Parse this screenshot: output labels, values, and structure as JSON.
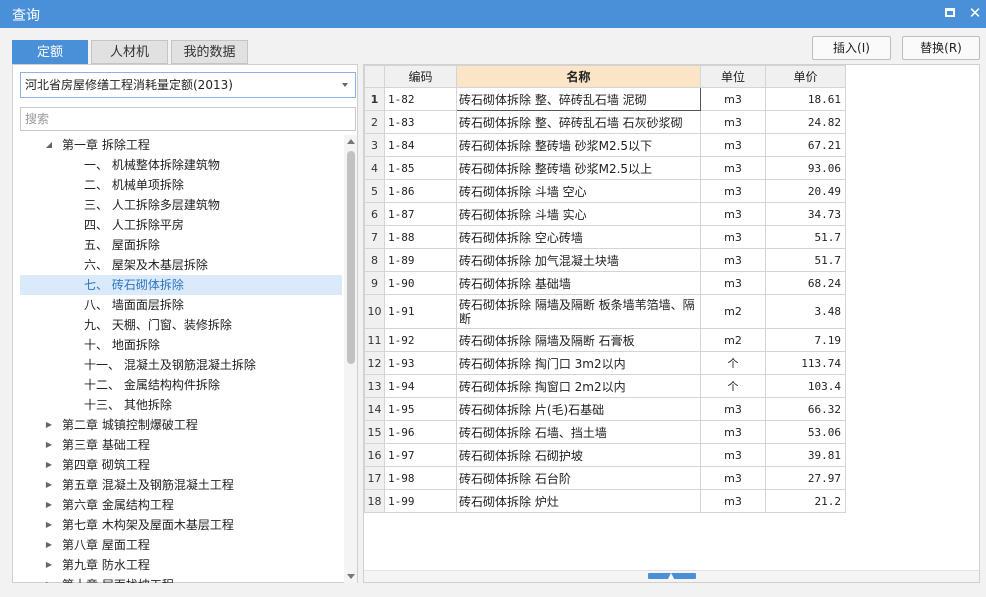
{
  "window": {
    "title": "查询",
    "maximize_label": "",
    "close_label": "✕"
  },
  "tabs": [
    {
      "label": "定额",
      "active": true
    },
    {
      "label": "人材机",
      "active": false
    },
    {
      "label": "我的数据",
      "active": false
    }
  ],
  "actions": {
    "insert_label": "插入(I)",
    "replace_label": "替换(R)"
  },
  "left": {
    "quota_select_value": "河北省房屋修缮工程消耗量定额(2013)",
    "search_placeholder": "搜索",
    "tree": [
      {
        "label": "第一章 拆除工程",
        "level": 1,
        "expanded": true,
        "selected": false
      },
      {
        "label": "一、 机械整体拆除建筑物",
        "level": 2,
        "selected": false
      },
      {
        "label": "二、 机械单项拆除",
        "level": 2,
        "selected": false
      },
      {
        "label": "三、 人工拆除多层建筑物",
        "level": 2,
        "selected": false
      },
      {
        "label": "四、 人工拆除平房",
        "level": 2,
        "selected": false
      },
      {
        "label": "五、 屋面拆除",
        "level": 2,
        "selected": false
      },
      {
        "label": "六、 屋架及木基层拆除",
        "level": 2,
        "selected": false
      },
      {
        "label": "七、 砖石砌体拆除",
        "level": 2,
        "selected": true
      },
      {
        "label": "八、 墙面面层拆除",
        "level": 2,
        "selected": false
      },
      {
        "label": "九、 天棚、门窗、装修拆除",
        "level": 2,
        "selected": false
      },
      {
        "label": "十、 地面拆除",
        "level": 2,
        "selected": false
      },
      {
        "label": "十一、 混凝土及钢筋混凝土拆除",
        "level": 2,
        "selected": false
      },
      {
        "label": "十二、 金属结构构件拆除",
        "level": 2,
        "selected": false
      },
      {
        "label": "十三、 其他拆除",
        "level": 2,
        "selected": false
      },
      {
        "label": "第二章 城镇控制爆破工程",
        "level": 1,
        "expanded": false,
        "selected": false
      },
      {
        "label": "第三章 基础工程",
        "level": 1,
        "expanded": false,
        "selected": false
      },
      {
        "label": "第四章 砌筑工程",
        "level": 1,
        "expanded": false,
        "selected": false
      },
      {
        "label": "第五章 混凝土及钢筋混凝土工程",
        "level": 1,
        "expanded": false,
        "selected": false
      },
      {
        "label": "第六章 金属结构工程",
        "level": 1,
        "expanded": false,
        "selected": false
      },
      {
        "label": "第七章 木构架及屋面木基层工程",
        "level": 1,
        "expanded": false,
        "selected": false
      },
      {
        "label": "第八章 屋面工程",
        "level": 1,
        "expanded": false,
        "selected": false
      },
      {
        "label": "第九章 防水工程",
        "level": 1,
        "expanded": false,
        "selected": false
      },
      {
        "label": "第十章 层面找坡工程",
        "level": 1,
        "expanded": false,
        "selected": false
      }
    ]
  },
  "grid": {
    "columns": [
      "编码",
      "名称",
      "单位",
      "单价"
    ],
    "sorted_column": "名称",
    "rows": [
      {
        "idx": "1",
        "code": "1-82",
        "name": "砖石砌体拆除 整、碎砖乱石墙 泥砌",
        "unit": "m3",
        "price": "18.61"
      },
      {
        "idx": "2",
        "code": "1-83",
        "name": "砖石砌体拆除 整、碎砖乱石墙 石灰砂浆砌",
        "unit": "m3",
        "price": "24.82"
      },
      {
        "idx": "3",
        "code": "1-84",
        "name": "砖石砌体拆除 整砖墙 砂浆M2.5以下",
        "unit": "m3",
        "price": "67.21"
      },
      {
        "idx": "4",
        "code": "1-85",
        "name": "砖石砌体拆除 整砖墙 砂浆M2.5以上",
        "unit": "m3",
        "price": "93.06"
      },
      {
        "idx": "5",
        "code": "1-86",
        "name": "砖石砌体拆除 斗墙 空心",
        "unit": "m3",
        "price": "20.49"
      },
      {
        "idx": "6",
        "code": "1-87",
        "name": "砖石砌体拆除 斗墙 实心",
        "unit": "m3",
        "price": "34.73"
      },
      {
        "idx": "7",
        "code": "1-88",
        "name": "砖石砌体拆除 空心砖墙",
        "unit": "m3",
        "price": "51.7"
      },
      {
        "idx": "8",
        "code": "1-89",
        "name": "砖石砌体拆除 加气混凝土块墙",
        "unit": "m3",
        "price": "51.7"
      },
      {
        "idx": "9",
        "code": "1-90",
        "name": "砖石砌体拆除 基础墙",
        "unit": "m3",
        "price": "68.24"
      },
      {
        "idx": "10",
        "code": "1-91",
        "name": "砖石砌体拆除 隔墙及隔断 板条墙苇箔墙、隔断",
        "unit": "m2",
        "price": "3.48"
      },
      {
        "idx": "11",
        "code": "1-92",
        "name": "砖石砌体拆除 隔墙及隔断 石膏板",
        "unit": "m2",
        "price": "7.19"
      },
      {
        "idx": "12",
        "code": "1-93",
        "name": "砖石砌体拆除 掏门口 3m2以内",
        "unit": "个",
        "price": "113.74"
      },
      {
        "idx": "13",
        "code": "1-94",
        "name": "砖石砌体拆除 掏窗口 2m2以内",
        "unit": "个",
        "price": "103.4"
      },
      {
        "idx": "14",
        "code": "1-95",
        "name": "砖石砌体拆除 片(毛)石基础",
        "unit": "m3",
        "price": "66.32"
      },
      {
        "idx": "15",
        "code": "1-96",
        "name": "砖石砌体拆除 石墙、挡土墙",
        "unit": "m3",
        "price": "53.06"
      },
      {
        "idx": "16",
        "code": "1-97",
        "name": "砖石砌体拆除 石砌护坡",
        "unit": "m3",
        "price": "39.81"
      },
      {
        "idx": "17",
        "code": "1-98",
        "name": "砖石砌体拆除 石台阶",
        "unit": "m3",
        "price": "27.97"
      },
      {
        "idx": "18",
        "code": "1-99",
        "name": "砖石砌体拆除 炉灶",
        "unit": "m3",
        "price": "21.2"
      }
    ]
  },
  "colors": {
    "accent": "#4a90d9",
    "selected_row_bg": "#dbeafa",
    "sorted_header_bg": "#fbe5c6"
  }
}
